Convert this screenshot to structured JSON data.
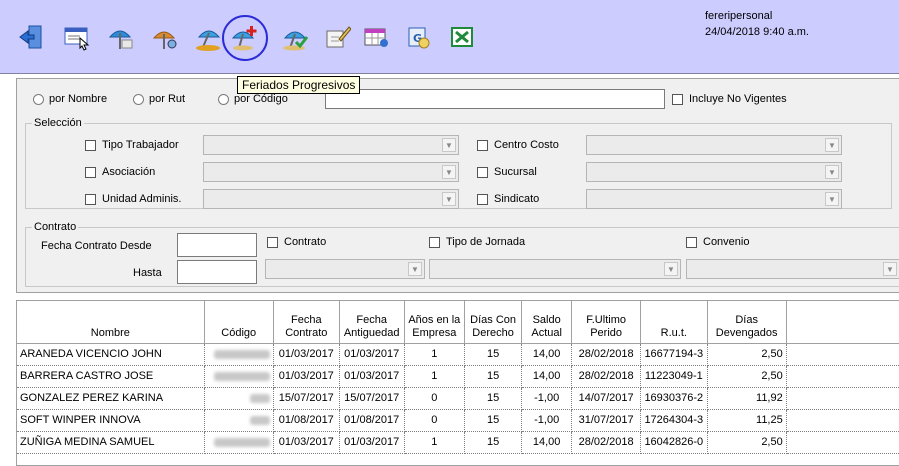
{
  "toolbar": {
    "icons": [
      {
        "name": "exit-door-icon",
        "color": "#2a6fd6"
      },
      {
        "name": "window-select-icon",
        "color": "#3b5fbf"
      },
      {
        "name": "vacation-list-icon",
        "color": "#2e8bd8"
      },
      {
        "name": "vacation-settings-icon",
        "color": "#d88a2e"
      },
      {
        "name": "vacation-beach-icon",
        "color": "#e0a020"
      },
      {
        "name": "progressive-holidays-icon",
        "color": "#d82020"
      },
      {
        "name": "vacation-approve-icon",
        "color": "#2aa040"
      },
      {
        "name": "edit-document-icon",
        "color": "#6a6a6a"
      },
      {
        "name": "report-table-icon",
        "color": "#c040c0"
      },
      {
        "name": "word-export-icon",
        "color": "#2a5fb0"
      },
      {
        "name": "excel-export-icon",
        "color": "#1f8a3a"
      }
    ],
    "user": "fereripersonal",
    "datetime": "24/04/2018 9:40 a.m.",
    "tooltip": "Feriados Progresivos"
  },
  "search": {
    "radio_nombre": "por Nombre",
    "radio_rut": "por Rut",
    "radio_codigo": "por Código",
    "value": "",
    "incluye_no_vigentes": "Incluye No Vigentes"
  },
  "seleccion": {
    "legend": "Selección",
    "tipo_trabajador": "Tipo Trabajador",
    "asociacion": "Asociación",
    "unidad_adminis": "Unidad Adminis.",
    "centro_costo": "Centro Costo",
    "sucursal": "Sucursal",
    "sindicato": "Sindicato"
  },
  "contrato": {
    "legend": "Contrato",
    "fecha_desde": "Fecha Contrato Desde",
    "hasta": "Hasta",
    "chk_contrato": "Contrato",
    "chk_tipo_jornada": "Tipo de Jornada",
    "chk_convenio": "Convenio"
  },
  "grid": {
    "headers": {
      "nombre": "Nombre",
      "codigo": "Código",
      "fecha_contrato_1": "Fecha",
      "fecha_contrato_2": "Contrato",
      "fecha_antig_1": "Fecha",
      "fecha_antig_2": "Antiguedad",
      "anios_1": "Años en la",
      "anios_2": "Empresa",
      "dias_con_1": "Días Con",
      "dias_con_2": "Derecho",
      "saldo_1": "Saldo",
      "saldo_2": "Actual",
      "fultimo_1": "F.Ultimo",
      "fultimo_2": "Perido",
      "rut": "R.u.t.",
      "dias_dev_1": "Días",
      "dias_dev_2": "Devengados"
    },
    "rows": [
      {
        "nombre": "ARANEDA VICENCIO JOHN",
        "fecha_contrato": "01/03/2017",
        "fecha_antig": "01/03/2017",
        "anios": "1",
        "dias_con": "15",
        "saldo": "14,00",
        "fultimo": "28/02/2018",
        "rut": "16677194-3",
        "dias_dev": "2,50"
      },
      {
        "nombre": "BARRERA CASTRO JOSE",
        "fecha_contrato": "01/03/2017",
        "fecha_antig": "01/03/2017",
        "anios": "1",
        "dias_con": "15",
        "saldo": "14,00",
        "fultimo": "28/02/2018",
        "rut": "11223049-1",
        "dias_dev": "2,50"
      },
      {
        "nombre": "GONZALEZ PEREZ KARINA",
        "fecha_contrato": "15/07/2017",
        "fecha_antig": "15/07/2017",
        "anios": "0",
        "dias_con": "15",
        "saldo": "-1,00",
        "fultimo": "14/07/2017",
        "rut": "16930376-2",
        "dias_dev": "11,92"
      },
      {
        "nombre": "SOFT WINPER INNOVA",
        "fecha_contrato": "01/08/2017",
        "fecha_antig": "01/08/2017",
        "anios": "0",
        "dias_con": "15",
        "saldo": "-1,00",
        "fultimo": "31/07/2017",
        "rut": "17264304-3",
        "dias_dev": "11,25"
      },
      {
        "nombre": "ZUÑIGA MEDINA SAMUEL",
        "fecha_contrato": "01/03/2017",
        "fecha_antig": "01/03/2017",
        "anios": "1",
        "dias_con": "15",
        "saldo": "14,00",
        "fultimo": "28/02/2018",
        "rut": "16042826-0",
        "dias_dev": "2,50"
      }
    ]
  }
}
